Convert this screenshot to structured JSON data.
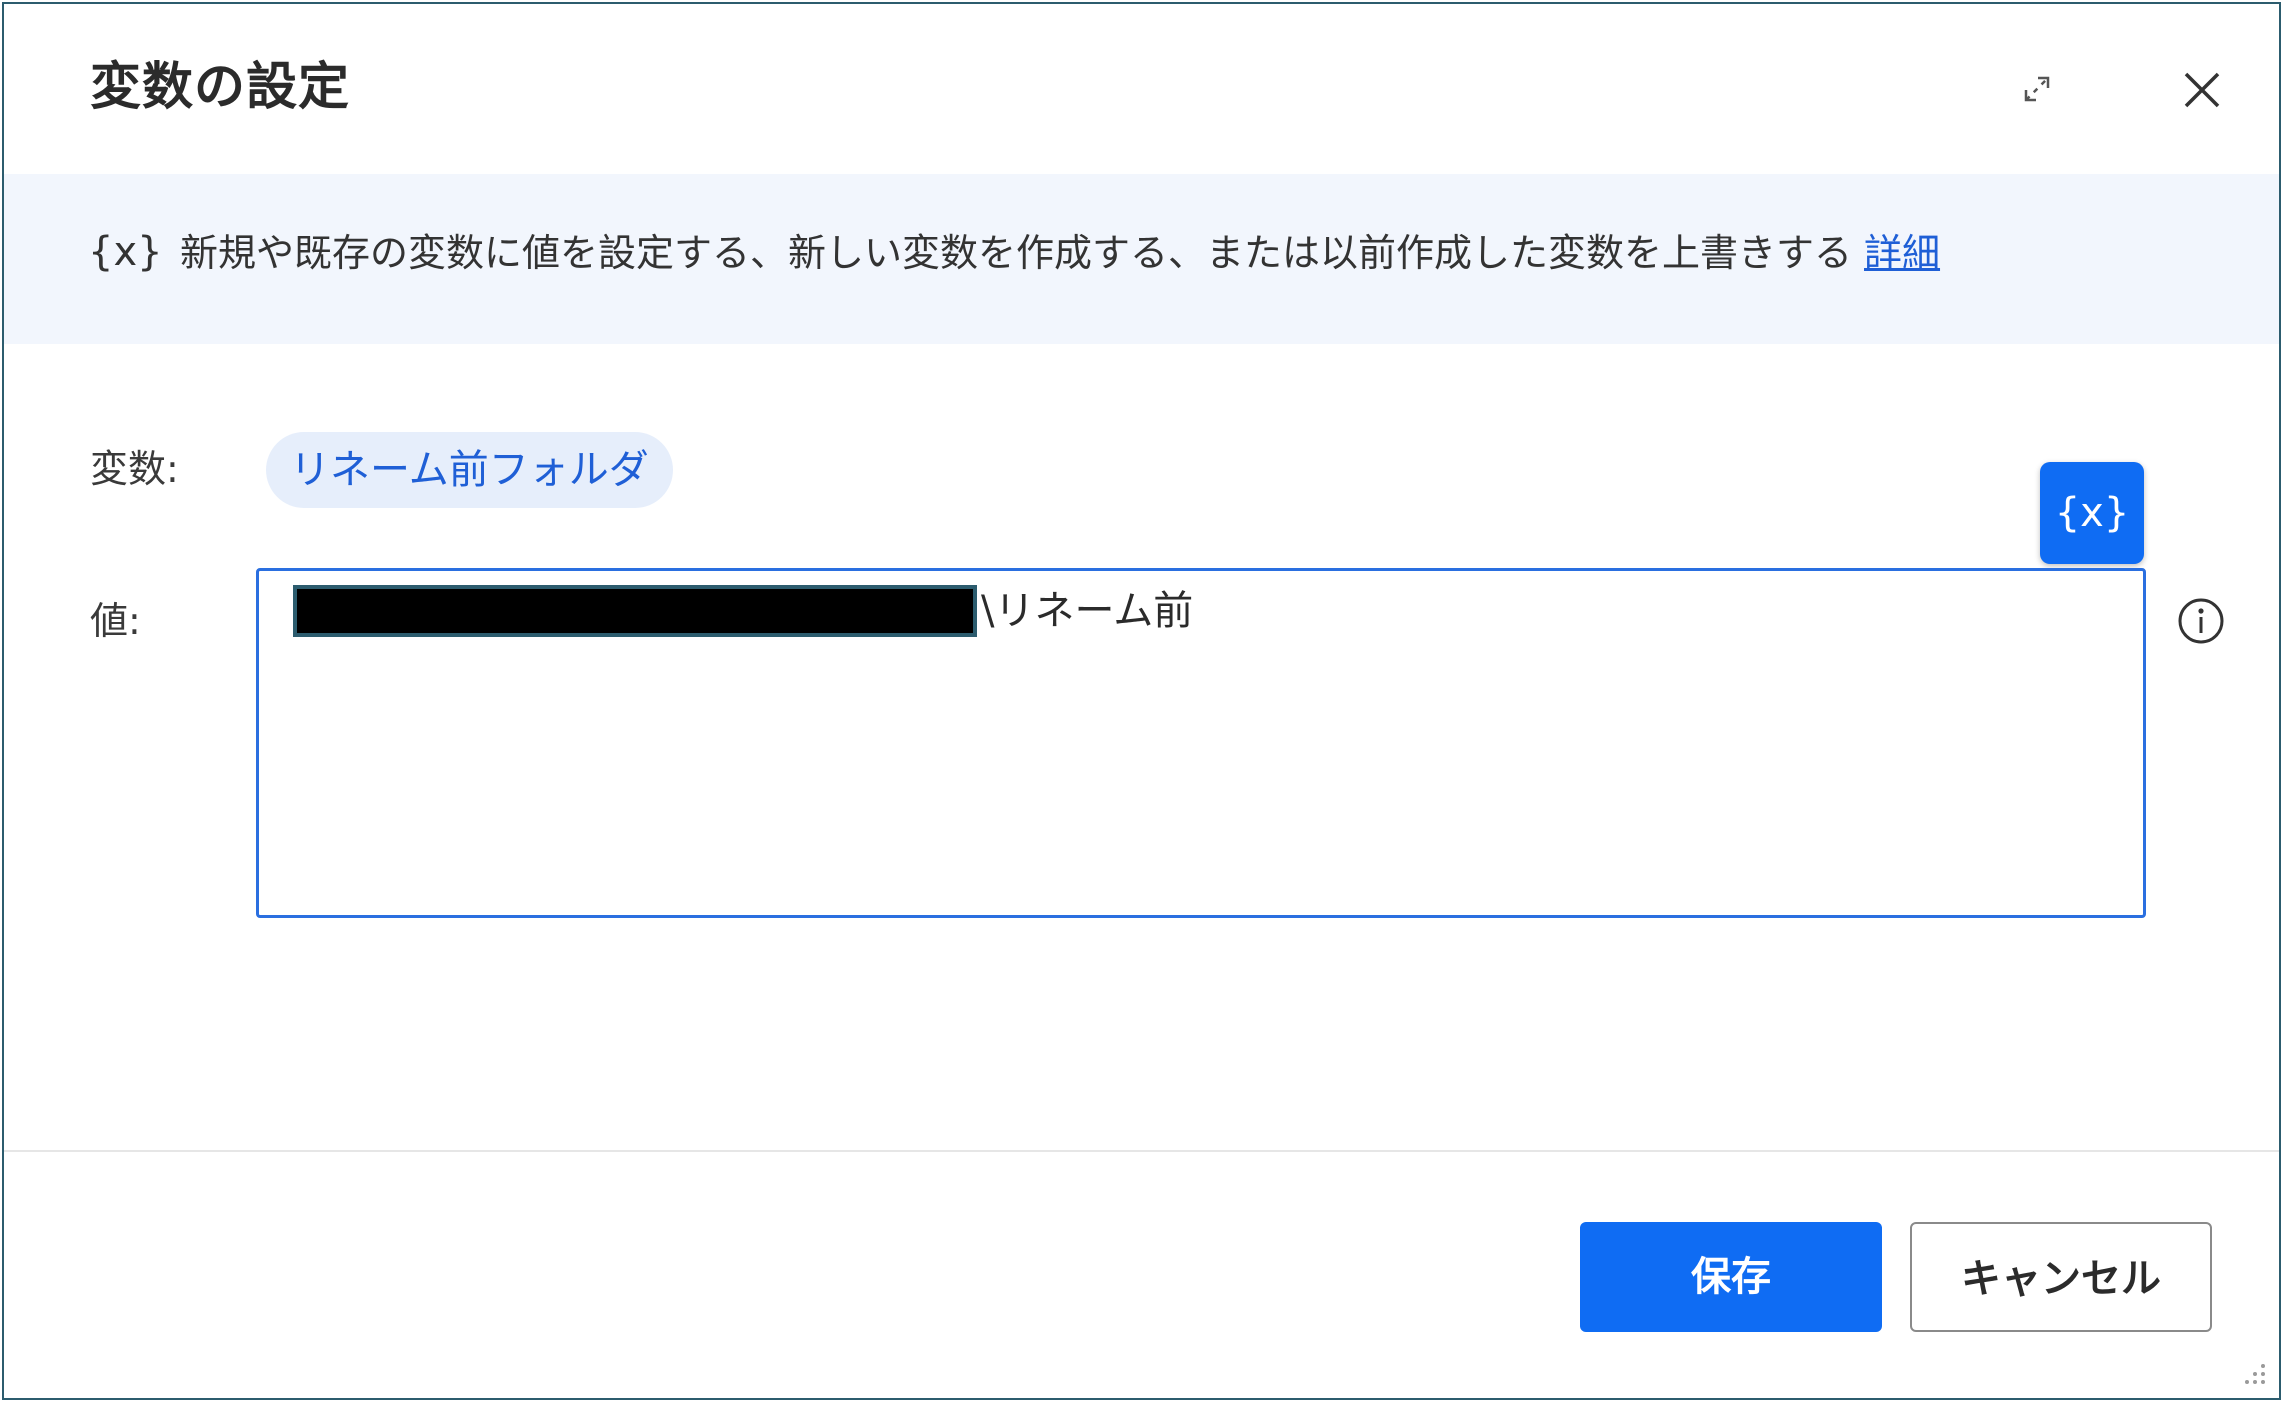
{
  "dialog": {
    "title": "変数の設定",
    "expand_icon": "expand-icon",
    "close_icon": "close-icon"
  },
  "info_band": {
    "icon": "{x}",
    "description": "新規や既存の変数に値を設定する、新しい変数を作成する、または以前作成した変数を上書きする",
    "link_text": "詳細"
  },
  "form": {
    "variable_label": "変数:",
    "variable_name": "リネーム前フォルダ",
    "value_label": "値:",
    "value_suffix": "\\リネーム前",
    "insert_variable_label": "{x}",
    "info_icon": "info-icon"
  },
  "footer": {
    "save_label": "保存",
    "cancel_label": "キャンセル"
  },
  "colors": {
    "accent": "#0f6cf3",
    "link": "#1f5fd6",
    "band_background": "#f2f6fd",
    "chip_background": "#e6eefb"
  }
}
